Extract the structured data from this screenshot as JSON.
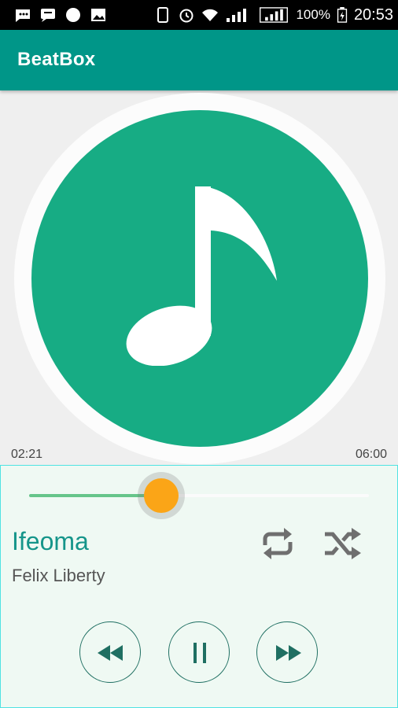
{
  "status_bar": {
    "battery": "100%",
    "time": "20:53"
  },
  "app_bar": {
    "title": "BeatBox"
  },
  "player": {
    "elapsed": "02:21",
    "duration": "06:00",
    "progress_fraction": 0.39,
    "song_title": "Ifeoma",
    "artist": "Felix Liberty"
  },
  "icons": {
    "album_art": "music-note-icon",
    "repeat": "repeat-icon",
    "shuffle": "shuffle-icon",
    "rewind": "rewind-icon",
    "pause": "pause-icon",
    "fast_forward": "fast-forward-icon"
  },
  "colors": {
    "app_bar": "#009688",
    "album_disc": "#17ac84",
    "accent_title": "#15958a",
    "seek_fill": "#66c58a",
    "seek_thumb": "#fba517",
    "panel_bg": "#eff9f3"
  }
}
